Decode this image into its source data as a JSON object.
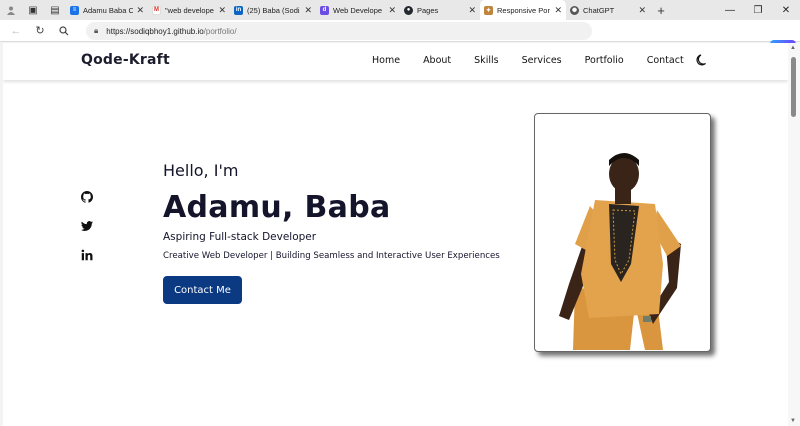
{
  "browser": {
    "tabs": [
      {
        "label": "Adamu Baba C",
        "favicon": "docs-icon",
        "color": "#1a73e8"
      },
      {
        "label": "\"web develope",
        "favicon": "gmail-icon",
        "color": "#d93025"
      },
      {
        "label": "(25) Baba (Sodi",
        "favicon": "linkedin-icon",
        "color": "#0a66c2"
      },
      {
        "label": "Web Develope",
        "favicon": "dev-icon",
        "color": "#6b4de6"
      },
      {
        "label": "Pages",
        "favicon": "github-icon",
        "color": "#24292f"
      },
      {
        "label": "Responsive Por",
        "favicon": "portfolio-icon",
        "color": "#c0843c"
      },
      {
        "label": "ChatGPT",
        "favicon": "chatgpt-icon",
        "color": "#555555"
      }
    ],
    "active_tab_index": 5,
    "address": {
      "host": "https://sodiqbhoy1.github.io",
      "path": "/portfolio/"
    }
  },
  "site": {
    "brand": "Qode-Kraft",
    "nav": {
      "home": "Home",
      "about": "About",
      "skills": "Skills",
      "services": "Services",
      "portfolio": "Portfolio",
      "contact": "Contact"
    },
    "hero": {
      "greeting": "Hello, I'm",
      "name": "Adamu, Baba",
      "role": "Aspiring Full-stack Developer",
      "tagline": "Creative Web Developer | Building Seamless and Interactive User Experiences",
      "cta": "Contact Me"
    },
    "socials": [
      "github-icon",
      "twitter-icon",
      "linkedin-icon"
    ],
    "colors": {
      "primary": "#0b3a82",
      "text": "#14142b"
    }
  }
}
